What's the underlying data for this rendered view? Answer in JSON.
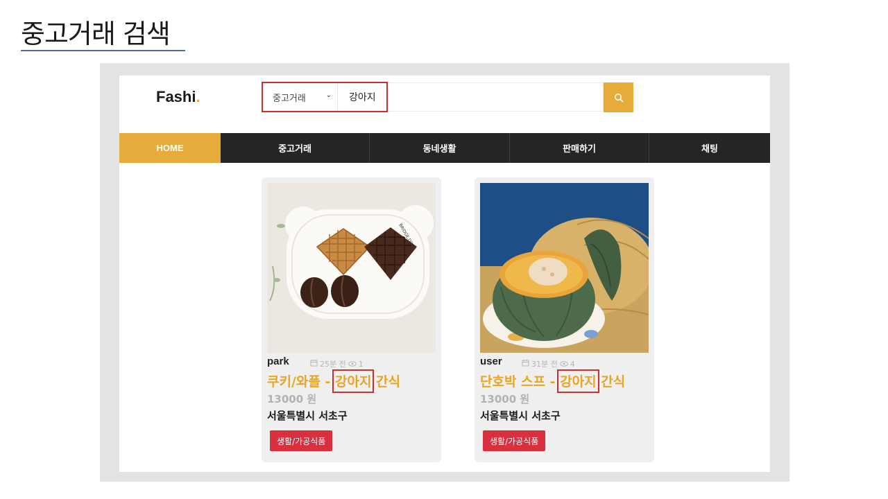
{
  "slide": {
    "title": "중고거래 검색"
  },
  "site": {
    "logo_text": "Fashi",
    "logo_dot": "."
  },
  "search": {
    "category": "중고거래",
    "query": "강아지"
  },
  "nav": {
    "items": [
      "HOME",
      "중고거래",
      "동네생활",
      "판매하기",
      "채팅"
    ]
  },
  "products": [
    {
      "user": "park",
      "time": "25분 전",
      "views": "1",
      "title_prefix": "쿠키/와플 - ",
      "keyword": "강아지",
      "title_suffix": " 간식",
      "price": "13000 원",
      "location": "서울특별시 서초구",
      "category": "생활/가공식품"
    },
    {
      "user": "user",
      "time": "31분 전",
      "views": "4",
      "title_prefix": "단호박 스프 - ",
      "keyword": "강아지",
      "title_suffix": " 간식",
      "price": "13000 원",
      "location": "서울특별시 서초구",
      "category": "생활/가공식품"
    }
  ],
  "colors": {
    "accent": "#e7ab3c",
    "nav_bg": "#252525",
    "badge": "#d9303f",
    "highlight": "#d32b2b"
  }
}
